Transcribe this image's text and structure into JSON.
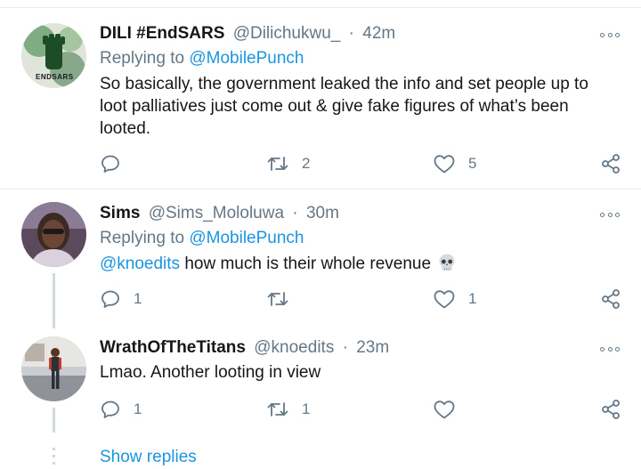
{
  "tweets": [
    {
      "name": "DILI #EndSARS",
      "handle": "@Dilichukwu_",
      "separator": "·",
      "time": "42m",
      "replying_prefix": "Replying to",
      "replying_to": "@MobilePunch",
      "text": "So basically, the government leaked the info and set people up to loot palliatives just come out & give fake figures of what’s been looted.",
      "avatar_caption": "ENDSARS",
      "counts": {
        "replies": "",
        "retweets": "2",
        "likes": "5"
      }
    },
    {
      "name": "Sims",
      "handle": "@Sims_Mololuwa",
      "separator": "·",
      "time": "30m",
      "replying_prefix": "Replying to",
      "replying_to": "@MobilePunch",
      "mention": "@knoedits",
      "text": "how much is their whole revenue",
      "emoji": "skull-emoji",
      "counts": {
        "replies": "1",
        "retweets": "",
        "likes": "1"
      }
    },
    {
      "name": "WrathOfTheTitans",
      "handle": "@knoedits",
      "separator": "·",
      "time": "23m",
      "text": "Lmao. Another looting in view",
      "counts": {
        "replies": "1",
        "retweets": "1",
        "likes": ""
      }
    }
  ],
  "show_replies": "Show replies",
  "colors": {
    "accent": "#1b95e0",
    "secondary_text": "#657786",
    "primary_text": "#14171a",
    "divider": "#e6ecf0"
  },
  "icons": [
    "reply-icon",
    "retweet-icon",
    "like-icon",
    "share-icon",
    "more-icon"
  ]
}
